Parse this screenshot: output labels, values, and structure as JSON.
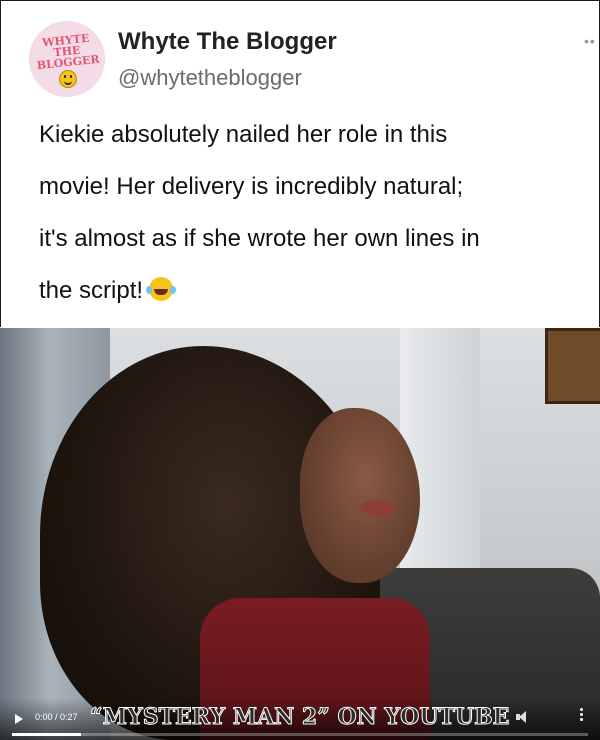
{
  "tweet": {
    "display_name": "Whyte The Blogger",
    "handle": "@whytetheblogger",
    "avatar": {
      "logo_text": "WHYTE THE BLOGGER",
      "icon": "smiley-icon"
    },
    "more_icon": "more-horizontal-icon",
    "text_lines": [
      "Kiekie absolutely nailed her role in this",
      "movie! Her delivery is incredibly natural;",
      "it's almost as if she wrote her own lines in",
      "the script!"
    ],
    "emoji": "laughing-with-tears-icon"
  },
  "video": {
    "current_time": "0:00",
    "duration": "0:27",
    "time_label": "0:00 / 0:27",
    "caption": "“MYSTERY MAN 2” ON YOUTUBE",
    "progress_fraction": 0.12,
    "play_icon": "play-icon",
    "volume_icon": "volume-icon",
    "menu_icon": "kebab-menu-icon"
  }
}
